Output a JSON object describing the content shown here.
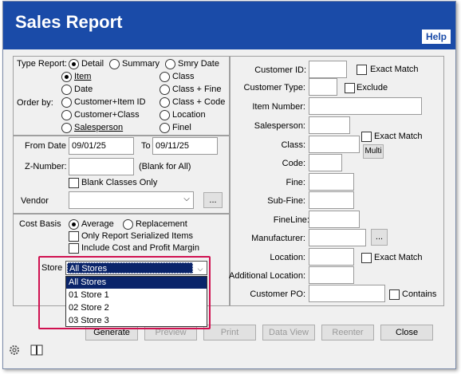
{
  "window": {
    "title": "Sales Report",
    "help_label": "Help"
  },
  "type_report": {
    "label": "Type Report:",
    "options": [
      "Detail",
      "Summary",
      "Smry Date"
    ],
    "selected": "Detail"
  },
  "order_by": {
    "label": "Order by:",
    "options": [
      "Item",
      "Class",
      "Date",
      "Class + Fine",
      "Customer+Item ID",
      "Class + Code",
      "Customer+Class",
      "Location",
      "Salesperson",
      "Finel"
    ],
    "selected": "Item"
  },
  "dates": {
    "from_label": "From Date",
    "from_value": "09/01/25",
    "to_label": "To",
    "to_value": "09/11/25",
    "znumber_label": "Z-Number:",
    "znumber_value": "",
    "znumber_hint": "(Blank for All)",
    "blank_classes_label": "Blank Classes Only",
    "vendor_label": "Vendor",
    "vendor_value": "",
    "vendor_browse": "..."
  },
  "cost": {
    "label": "Cost Basis",
    "options": [
      "Average",
      "Replacement"
    ],
    "selected": "Average",
    "serialized_label": "Only Report Serialized Items",
    "margin_label": "Include Cost and Profit Margin"
  },
  "store": {
    "label": "Store",
    "selected": "All Stores",
    "options": [
      "All Stores",
      "01 Store 1",
      "02 Store 2",
      "03 Store 3"
    ]
  },
  "filters": {
    "customer_id_label": "Customer ID:",
    "exact_match_label": "Exact Match",
    "customer_type_label": "Customer Type:",
    "exclude_label": "Exclude",
    "item_number_label": "Item Number:",
    "salesperson_label": "Salesperson:",
    "class_label": "Class:",
    "class_exact_label": "Exact Match",
    "multi_label": "Multi",
    "code_label": "Code:",
    "fine_label": "Fine:",
    "subfine_label": "Sub-Fine:",
    "fineline_label": "FineLine:",
    "manufacturer_label": "Manufacturer:",
    "manufacturer_browse": "...",
    "location_label": "Location:",
    "location_exact_label": "Exact Match",
    "additional_location_label": "Additional Location:",
    "customer_po_label": "Customer PO:",
    "contains_label": "Contains"
  },
  "buttons": {
    "generate": "Generate",
    "preview": "Preview",
    "print": "Print",
    "data_view": "Data View",
    "reenter": "Reenter",
    "close": "Close"
  },
  "colors": {
    "title_bar": "#1a4ba8",
    "dropdown_highlight": "#0a246a",
    "callout": "#d01050"
  }
}
